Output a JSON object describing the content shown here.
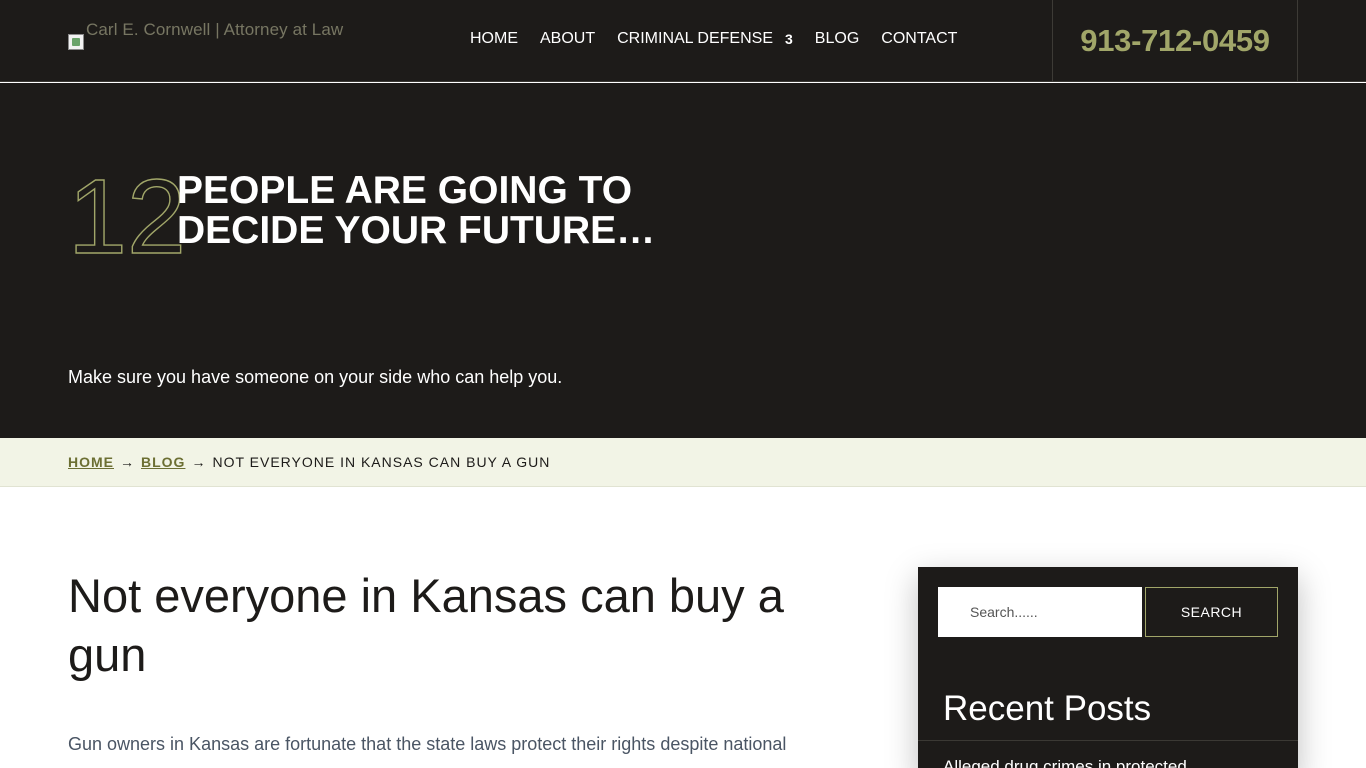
{
  "header": {
    "logo_alt": "Carl E. Cornwell | Attorney at Law",
    "nav": [
      {
        "label": "HOME"
      },
      {
        "label": "ABOUT"
      },
      {
        "label": "CRIMINAL DEFENSE",
        "indicator": "3"
      },
      {
        "label": "BLOG"
      },
      {
        "label": "CONTACT"
      }
    ],
    "phone": "913-712-0459"
  },
  "hero": {
    "number": "12",
    "title": "PEOPLE ARE GOING TO DECIDE YOUR FUTURE…",
    "subtitle": "Make sure you have someone on your side who can help you."
  },
  "breadcrumb": {
    "home": "HOME",
    "blog": "BLOG",
    "separator": "→",
    "current": "NOT EVERYONE IN KANSAS CAN BUY A GUN"
  },
  "article": {
    "title": "Not everyone in Kansas can buy a gun",
    "body_start": "Gun owners in Kansas are fortunate that the state laws protect their rights despite national"
  },
  "sidebar": {
    "search_placeholder": "Search......",
    "search_button": "SEARCH",
    "recent_title": "Recent Posts",
    "recent_posts": [
      "Alleged drug crimes in protected"
    ]
  },
  "colors": {
    "dark": "#1d1b19",
    "accent": "#a1a669",
    "breadcrumb_bg": "#f2f4e6",
    "link": "#6c6f33"
  }
}
